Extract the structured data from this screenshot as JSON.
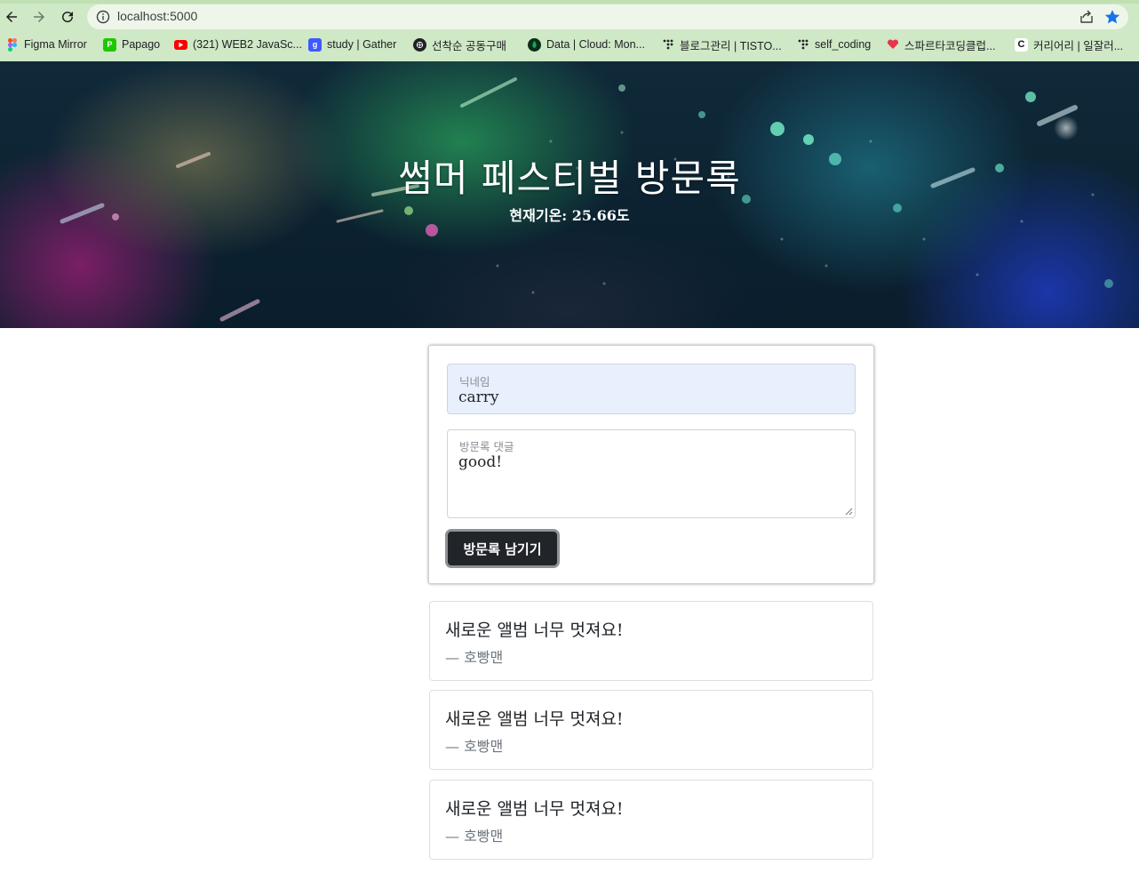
{
  "browser": {
    "url": "localhost:5000",
    "bookmarks": [
      {
        "label": "Figma Mirror",
        "icon": "figma-icon",
        "color": "#f24e1e"
      },
      {
        "label": "Papago",
        "icon": "papago-icon",
        "color": "#1ec800"
      },
      {
        "label": "(321) WEB2 JavaSc...",
        "icon": "youtube-icon",
        "color": "#ff0000"
      },
      {
        "label": "study | Gather",
        "icon": "gather-icon",
        "color": "#3d5afe"
      },
      {
        "label": "선착순 공동구매",
        "icon": "globe-icon",
        "color": "#202124"
      },
      {
        "label": "Data | Cloud: Mon...",
        "icon": "mongodb-icon",
        "color": "#13aa52"
      },
      {
        "label": "블로그관리 | TISTO...",
        "icon": "tistory-icon",
        "color": "#202124"
      },
      {
        "label": "self_coding",
        "icon": "tistory-icon",
        "color": "#202124"
      },
      {
        "label": "스파르타코딩클럽...",
        "icon": "sparta-icon",
        "color": "#e8344e"
      },
      {
        "label": "커리어리 | 일잘러...",
        "icon": "careerly-icon",
        "color": "#202124"
      }
    ]
  },
  "hero": {
    "title": "썸머 페스티벌 방문록",
    "weather": "현재기온: 25.66도"
  },
  "form": {
    "nickname_label": "닉네임",
    "nickname_value": "carry",
    "comment_label": "방문록 댓글",
    "comment_value": "good!",
    "submit_label": "방문록 남기기"
  },
  "comments": [
    {
      "text": "새로운 앨범 너무 멋져요!",
      "author": "— 호빵맨"
    },
    {
      "text": "새로운 앨범 너무 멋져요!",
      "author": "— 호빵맨"
    },
    {
      "text": "새로운 앨범 너무 멋져요!",
      "author": "— 호빵맨"
    }
  ]
}
